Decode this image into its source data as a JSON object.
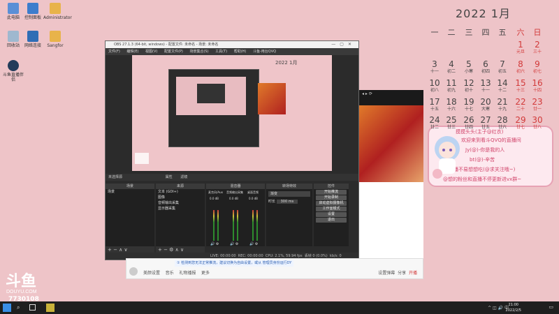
{
  "desktop": {
    "icons": [
      {
        "label": "此电脑",
        "icon": "computer-icon",
        "color": "#5a8fd6"
      },
      {
        "label": "控制面板",
        "icon": "control-panel-icon",
        "color": "#3d7dcc"
      },
      {
        "label": "Administrator",
        "icon": "user-folder-icon",
        "color": "#e8b34a"
      },
      {
        "label": "回收站",
        "icon": "recycle-bin-icon",
        "color": "#9fb8cf"
      },
      {
        "label": "网络连接",
        "icon": "network-icon",
        "color": "#2f6db5"
      },
      {
        "label": "Sangfor",
        "icon": "folder-icon",
        "color": "#e8b34a"
      },
      {
        "label": "斗鱼直播伴侣",
        "icon": "douyu-app-icon",
        "color": "#233c5a"
      }
    ]
  },
  "calendar": {
    "title": "2022  1月",
    "weekdays": [
      "一",
      "二",
      "三",
      "四",
      "五",
      "六",
      "日"
    ],
    "rows": [
      [
        null,
        null,
        null,
        null,
        null,
        {
          "d": "1",
          "l": "元旦"
        },
        {
          "d": "2",
          "l": "三十"
        }
      ],
      [
        {
          "d": "3",
          "l": "十一"
        },
        {
          "d": "4",
          "l": "初二"
        },
        {
          "d": "5",
          "l": "小寒"
        },
        {
          "d": "6",
          "l": "初四"
        },
        {
          "d": "7",
          "l": "初五"
        },
        {
          "d": "8",
          "l": "初六"
        },
        {
          "d": "9",
          "l": "初七"
        }
      ],
      [
        {
          "d": "10",
          "l": "初八"
        },
        {
          "d": "11",
          "l": "初九"
        },
        {
          "d": "12",
          "l": "初十"
        },
        {
          "d": "13",
          "l": "十一"
        },
        {
          "d": "14",
          "l": "十二"
        },
        {
          "d": "15",
          "l": "十三"
        },
        {
          "d": "16",
          "l": "十四"
        }
      ],
      [
        {
          "d": "17",
          "l": "十五"
        },
        {
          "d": "18",
          "l": "十六"
        },
        {
          "d": "19",
          "l": "十七"
        },
        {
          "d": "20",
          "l": "大寒"
        },
        {
          "d": "21",
          "l": "十九"
        },
        {
          "d": "22",
          "l": "二十"
        },
        {
          "d": "23",
          "l": "廿一"
        }
      ],
      [
        {
          "d": "24",
          "l": "廿二"
        },
        {
          "d": "25",
          "l": "廿三"
        },
        {
          "d": "26",
          "l": "廿四"
        },
        {
          "d": "27",
          "l": "廿五"
        },
        {
          "d": "28",
          "l": "廿六"
        },
        {
          "d": "29",
          "l": "廿七"
        },
        {
          "d": "30",
          "l": "廿八"
        }
      ]
    ]
  },
  "obs": {
    "title": "OBS 27.1.3 (64-bit, windows) - 配置文件: 未命名 - 场景: 未命名",
    "menu": [
      "文件(F)",
      "编辑(E)",
      "视图(V)",
      "配置文件(P)",
      "场景集合(S)",
      "工具(T)",
      "帮助(H)",
      "斗鱼-用台QVQ"
    ],
    "status_bar": {
      "source": "未选择源",
      "props": "属性",
      "filters": "滤镜"
    },
    "docks": {
      "scenes": {
        "header": "场景",
        "items": [
          "场景"
        ]
      },
      "sources": {
        "header": "来源",
        "items": [
          "文本 (GDI+)",
          "图像",
          "音频输出采集",
          "显示器采集"
        ]
      },
      "mixer": {
        "header": "混音器",
        "channels": [
          "麦克风/Aux",
          "音频输出采集",
          "桌面音频"
        ],
        "levels": [
          "0.0 dB",
          "0.0 dB",
          "0.0 dB"
        ]
      },
      "transitions": {
        "header": "转场特效",
        "type": "渐变",
        "duration_label": "时长",
        "duration": "300 ms"
      },
      "controls": {
        "header": "控件",
        "buttons": [
          "开始推流",
          "开始录制",
          "启动虚拟摄像机",
          "工作室模式",
          "设置",
          "退出"
        ]
      }
    },
    "status": {
      "live": "LIVE: 00:00:00",
      "rec": "REC: 00:00:00",
      "cpu": "CPU: 2.1%, 59.94 fps",
      "dropped": "丢帧 0 (0.0%)",
      "kbps": "kb/s: 0"
    }
  },
  "chat_overlay": {
    "lines": [
      "摸摸头头(主子@红衣)",
      "欢迎来到看斗QVQ的直播间",
      "Jy(@)-你是我的人",
      "bt(@)-辛苦",
      "直播不易想想吃(@求关注哦~)",
      "@想的粉丝和直播不停更新进vx群~"
    ]
  },
  "chat_bar": {
    "notice": "① 检测到您无法正常推流，建议切换为自由设置，或从 管理员身份运行DY",
    "tools": [
      "美颜设置",
      "音乐",
      "礼物播报",
      "更多"
    ],
    "right": [
      "设置弹幕",
      "分享",
      "开播"
    ]
  },
  "room": {
    "id": "7730108",
    "brand": "DOUYU.COM"
  },
  "taskbar": {
    "time": "21:00",
    "date": "2022/2/5"
  },
  "colors": {
    "desktop_bg": "#eec4c8",
    "accent_red": "#d23a3a"
  }
}
